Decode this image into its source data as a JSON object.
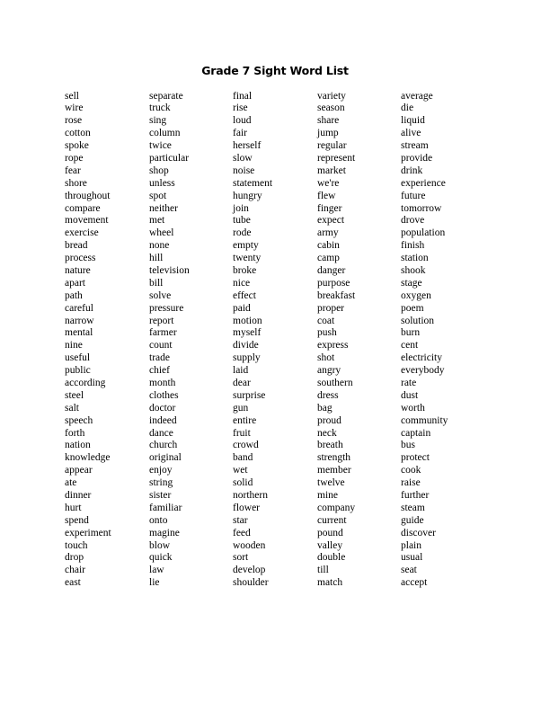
{
  "title": "Grade 7 Sight Word List",
  "columns": [
    [
      "sell",
      "wire",
      "rose",
      "cotton",
      "spoke",
      "rope",
      "fear",
      "shore",
      "throughout",
      "compare",
      "movement",
      "exercise",
      "bread",
      "process",
      "nature",
      "apart",
      "path",
      "careful",
      "narrow",
      "mental",
      "nine",
      "useful",
      "public",
      "according",
      "steel",
      "salt",
      "speech",
      "forth",
      "nation",
      "knowledge",
      "appear",
      "ate",
      "dinner",
      "hurt",
      "spend",
      "experiment",
      "touch",
      "drop",
      "chair",
      "east"
    ],
    [
      "separate",
      "truck",
      "sing",
      "column",
      "twice",
      "particular",
      "shop",
      "unless",
      "spot",
      "neither",
      "met",
      "wheel",
      "none",
      "hill",
      "television",
      "bill",
      "solve",
      "pressure",
      "report",
      "farmer",
      "count",
      "trade",
      "chief",
      "month",
      "clothes",
      "doctor",
      "indeed",
      "dance",
      "church",
      "original",
      "enjoy",
      "string",
      "sister",
      "familiar",
      "onto",
      "magine",
      "blow",
      "quick",
      "law",
      "lie"
    ],
    [
      "final",
      "rise",
      "loud",
      "fair",
      "herself",
      "slow",
      "noise",
      "statement",
      "hungry",
      "join",
      "tube",
      "rode",
      "empty",
      "twenty",
      "broke",
      "nice",
      "effect",
      "paid",
      "motion",
      "myself",
      "divide",
      "supply",
      "laid",
      "dear",
      "surprise",
      "gun",
      "entire",
      "fruit",
      "crowd",
      "band",
      "wet",
      "solid",
      "northern",
      "flower",
      "star",
      "feed",
      "wooden",
      "sort",
      "develop",
      "shoulder"
    ],
    [
      "variety",
      "season",
      "share",
      "jump",
      "regular",
      "represent",
      "market",
      "we're",
      "flew",
      "finger",
      "expect",
      "army",
      "cabin",
      "camp",
      "danger",
      "purpose",
      "breakfast",
      "proper",
      "coat",
      "push",
      "express",
      "shot",
      "angry",
      "southern",
      "dress",
      "bag",
      "proud",
      "neck",
      "breath",
      "strength",
      "member",
      "twelve",
      "mine",
      "company",
      "current",
      "pound",
      "valley",
      "double",
      "till",
      "match"
    ],
    [
      "average",
      "die",
      "liquid",
      "alive",
      "stream",
      "provide",
      "drink",
      "experience",
      "future",
      "tomorrow",
      "drove",
      "population",
      "finish",
      "station",
      "shook",
      "stage",
      "oxygen",
      "poem",
      "solution",
      "burn",
      "cent",
      "electricity",
      "everybody",
      "rate",
      "dust",
      "worth",
      "community",
      "captain",
      "bus",
      "protect",
      "cook",
      "raise",
      "further",
      "steam",
      "guide",
      "discover",
      "plain",
      "usual",
      "seat",
      "accept"
    ]
  ]
}
